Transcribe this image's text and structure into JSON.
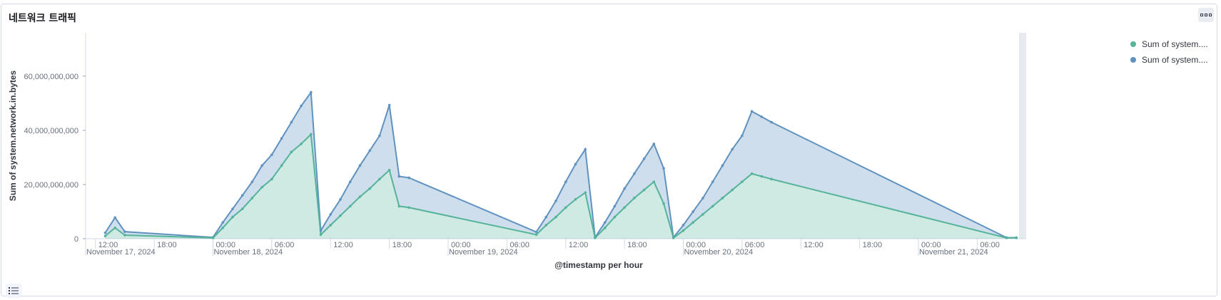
{
  "panel": {
    "title": "네트워크 트래픽"
  },
  "legend": {
    "items": [
      {
        "label": "Sum of system....",
        "color": "#54b399"
      },
      {
        "label": "Sum of system....",
        "color": "#6092c0"
      }
    ]
  },
  "colors": {
    "inbound": "#54b399",
    "outbound": "#6092c0",
    "grid_shade": "#e6e9ee"
  },
  "icons": {
    "panel_menu": "ellipsis-icon",
    "legend_toggle": "list-icon"
  },
  "chart_data": {
    "type": "area",
    "stacked": true,
    "xlabel": "@timestamp per hour",
    "ylabel": "Sum of system.network.in.bytes",
    "ylim": [
      0,
      76000000000
    ],
    "y_ticks": [
      0,
      20000000000,
      40000000000,
      60000000000
    ],
    "y_tick_labels": [
      "0",
      "20,000,000,000",
      "40,000,000,000",
      "60,000,000,000"
    ],
    "x_range": [
      "2024-11-17T11:00",
      "2024-11-21T11:00"
    ],
    "x_ticks": [
      {
        "at": "2024-11-17T12:00",
        "label": "12:00"
      },
      {
        "at": "2024-11-17T18:00",
        "label": "18:00"
      },
      {
        "at": "2024-11-18T00:00",
        "label": "00:00"
      },
      {
        "at": "2024-11-18T06:00",
        "label": "06:00"
      },
      {
        "at": "2024-11-18T12:00",
        "label": "12:00"
      },
      {
        "at": "2024-11-18T18:00",
        "label": "18:00"
      },
      {
        "at": "2024-11-19T00:00",
        "label": "00:00"
      },
      {
        "at": "2024-11-19T06:00",
        "label": "06:00"
      },
      {
        "at": "2024-11-19T12:00",
        "label": "12:00"
      },
      {
        "at": "2024-11-19T18:00",
        "label": "18:00"
      },
      {
        "at": "2024-11-20T00:00",
        "label": "00:00"
      },
      {
        "at": "2024-11-20T06:00",
        "label": "06:00"
      },
      {
        "at": "2024-11-20T12:00",
        "label": "12:00"
      },
      {
        "at": "2024-11-20T18:00",
        "label": "18:00"
      },
      {
        "at": "2024-11-21T00:00",
        "label": "00:00"
      },
      {
        "at": "2024-11-21T06:00",
        "label": "06:00"
      }
    ],
    "x_date_labels": [
      {
        "at": "2024-11-17T11:00",
        "label": "November 17, 2024"
      },
      {
        "at": "2024-11-18T00:00",
        "label": "November 18, 2024"
      },
      {
        "at": "2024-11-19T00:00",
        "label": "November 19, 2024"
      },
      {
        "at": "2024-11-20T00:00",
        "label": "November 20, 2024"
      },
      {
        "at": "2024-11-21T00:00",
        "label": "November 21, 2024"
      }
    ],
    "x": [
      "2024-11-17T13:00",
      "2024-11-17T14:00",
      "2024-11-17T15:00",
      "2024-11-18T00:00",
      "2024-11-18T01:00",
      "2024-11-18T02:00",
      "2024-11-18T03:00",
      "2024-11-18T04:00",
      "2024-11-18T05:00",
      "2024-11-18T06:00",
      "2024-11-18T07:00",
      "2024-11-18T08:00",
      "2024-11-18T09:00",
      "2024-11-18T10:00",
      "2024-11-18T11:00",
      "2024-11-18T12:00",
      "2024-11-18T13:00",
      "2024-11-18T14:00",
      "2024-11-18T15:00",
      "2024-11-18T16:00",
      "2024-11-18T17:00",
      "2024-11-18T18:00",
      "2024-11-18T19:00",
      "2024-11-18T20:00",
      "2024-11-19T09:00",
      "2024-11-19T10:00",
      "2024-11-19T11:00",
      "2024-11-19T12:00",
      "2024-11-19T13:00",
      "2024-11-19T14:00",
      "2024-11-19T15:00",
      "2024-11-19T16:00",
      "2024-11-19T17:00",
      "2024-11-19T18:00",
      "2024-11-19T19:00",
      "2024-11-19T20:00",
      "2024-11-19T21:00",
      "2024-11-19T22:00",
      "2024-11-19T23:00",
      "2024-11-20T00:00",
      "2024-11-20T01:00",
      "2024-11-20T02:00",
      "2024-11-20T03:00",
      "2024-11-20T04:00",
      "2024-11-20T05:00",
      "2024-11-20T06:00",
      "2024-11-20T07:00",
      "2024-11-20T08:00",
      "2024-11-20T09:00",
      "2024-11-21T09:00",
      "2024-11-21T10:00"
    ],
    "series": [
      {
        "values": [
          1000000000,
          4000000000,
          1300000000,
          300000000,
          4000000000,
          8000000000,
          11000000000,
          15000000000,
          19000000000,
          22000000000,
          27000000000,
          32000000000,
          35000000000,
          38500000000,
          1500000000,
          5000000000,
          8500000000,
          12000000000,
          15500000000,
          18500000000,
          22000000000,
          25300000000,
          12000000000,
          11500000000,
          1500000000,
          5000000000,
          8000000000,
          11500000000,
          14500000000,
          17000000000,
          300000000,
          4000000000,
          8000000000,
          11500000000,
          15000000000,
          18000000000,
          21000000000,
          13000000000,
          300000000,
          3000000000,
          6000000000,
          9000000000,
          12000000000,
          15000000000,
          18000000000,
          21000000000,
          24000000000,
          23000000000,
          22000000000,
          300000000,
          300000000
        ]
      },
      {
        "values": [
          1200000000,
          3800000000,
          1300000000,
          200000000,
          2000000000,
          3000000000,
          5000000000,
          6000000000,
          8000000000,
          9000000000,
          10000000000,
          11000000000,
          14000000000,
          15500000000,
          1500000000,
          4000000000,
          6000000000,
          9000000000,
          11500000000,
          14000000000,
          16000000000,
          24000000000,
          11000000000,
          11000000000,
          1000000000,
          3000000000,
          6000000000,
          9500000000,
          13000000000,
          16000000000,
          200000000,
          2000000000,
          4000000000,
          7000000000,
          9000000000,
          11500000000,
          14000000000,
          13000000000,
          200000000,
          2000000000,
          4000000000,
          6000000000,
          9000000000,
          12000000000,
          15000000000,
          17000000000,
          23000000000,
          22000000000,
          21000000000,
          100000000,
          100000000
        ]
      }
    ]
  }
}
